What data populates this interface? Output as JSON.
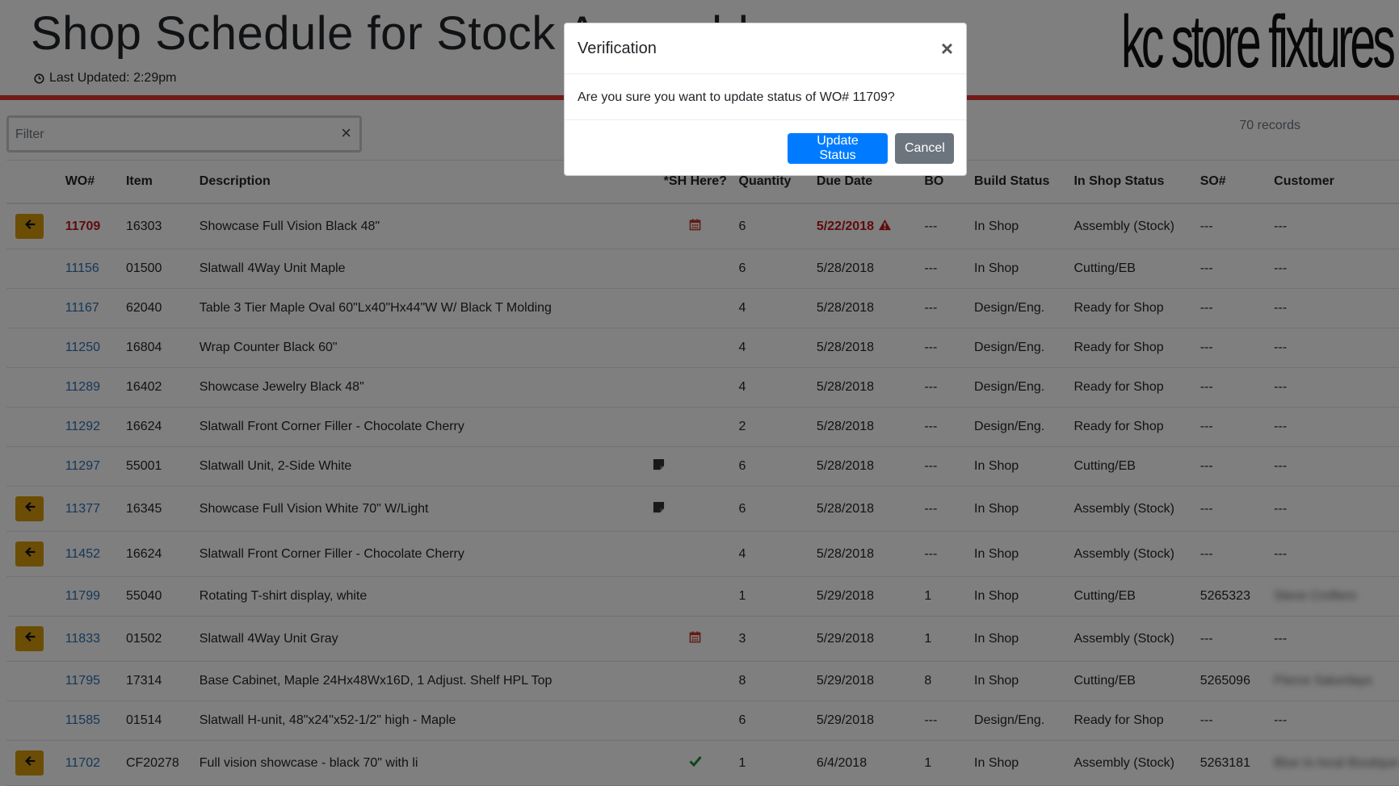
{
  "header": {
    "title": "Shop Schedule for Stock Assembly",
    "last_updated": "Last Updated: 2:29pm",
    "logo_text": "kc store fixtures"
  },
  "filter": {
    "placeholder": "Filter",
    "value": ""
  },
  "records_count": "70 records",
  "table": {
    "columns": [
      "WO#",
      "Item",
      "Description",
      "*SH Here?",
      "Quantity",
      "Due Date",
      "BO",
      "Build Status",
      "In Shop Status",
      "SO#",
      "Customer"
    ],
    "rows": [
      {
        "action": true,
        "wo": "11709",
        "item": "16303",
        "description": "Showcase Full Vision Black 48\"",
        "sh": "calendar",
        "quantity": "6",
        "due": "5/22/2018",
        "overdue": true,
        "bo": "---",
        "build": "In Shop",
        "inshop": "Assembly (Stock)",
        "so": "---",
        "customer": "---"
      },
      {
        "action": false,
        "wo": "11156",
        "item": "01500",
        "description": "Slatwall 4Way Unit Maple",
        "sh": "",
        "quantity": "6",
        "due": "5/28/2018",
        "overdue": false,
        "bo": "---",
        "build": "In Shop",
        "inshop": "Cutting/EB",
        "so": "---",
        "customer": "---"
      },
      {
        "action": false,
        "wo": "11167",
        "item": "62040",
        "description": "Table 3 Tier Maple Oval 60\"Lx40\"Hx44\"W W/ Black T Molding",
        "sh": "",
        "quantity": "4",
        "due": "5/28/2018",
        "overdue": false,
        "bo": "---",
        "build": "Design/Eng.",
        "inshop": "Ready for Shop",
        "so": "---",
        "customer": "---"
      },
      {
        "action": false,
        "wo": "11250",
        "item": "16804",
        "description": "Wrap Counter Black 60\"",
        "sh": "",
        "quantity": "4",
        "due": "5/28/2018",
        "overdue": false,
        "bo": "---",
        "build": "Design/Eng.",
        "inshop": "Ready for Shop",
        "so": "---",
        "customer": "---"
      },
      {
        "action": false,
        "wo": "11289",
        "item": "16402",
        "description": "Showcase Jewelry Black 48\"",
        "sh": "",
        "quantity": "4",
        "due": "5/28/2018",
        "overdue": false,
        "bo": "---",
        "build": "Design/Eng.",
        "inshop": "Ready for Shop",
        "so": "---",
        "customer": "---"
      },
      {
        "action": false,
        "wo": "11292",
        "item": "16624",
        "description": "Slatwall Front Corner Filler - Chocolate Cherry",
        "sh": "",
        "quantity": "2",
        "due": "5/28/2018",
        "overdue": false,
        "bo": "---",
        "build": "Design/Eng.",
        "inshop": "Ready for Shop",
        "so": "---",
        "customer": "---"
      },
      {
        "action": false,
        "wo": "11297",
        "item": "55001",
        "description": "Slatwall Unit, 2-Side White",
        "sh": "note",
        "quantity": "6",
        "due": "5/28/2018",
        "overdue": false,
        "bo": "---",
        "build": "In Shop",
        "inshop": "Cutting/EB",
        "so": "---",
        "customer": "---"
      },
      {
        "action": true,
        "wo": "11377",
        "item": "16345",
        "description": "Showcase Full Vision White 70\" W/Light",
        "sh": "note",
        "quantity": "6",
        "due": "5/28/2018",
        "overdue": false,
        "bo": "---",
        "build": "In Shop",
        "inshop": "Assembly (Stock)",
        "so": "---",
        "customer": "---"
      },
      {
        "action": true,
        "wo": "11452",
        "item": "16624",
        "description": "Slatwall Front Corner Filler - Chocolate Cherry",
        "sh": "",
        "quantity": "4",
        "due": "5/28/2018",
        "overdue": false,
        "bo": "---",
        "build": "In Shop",
        "inshop": "Assembly (Stock)",
        "so": "---",
        "customer": "---"
      },
      {
        "action": false,
        "wo": "11799",
        "item": "55040",
        "description": "Rotating T-shirt display, white",
        "sh": "",
        "quantity": "1",
        "due": "5/29/2018",
        "overdue": false,
        "bo": "1",
        "build": "In Shop",
        "inshop": "Cutting/EB",
        "so": "5265323",
        "customer": "Steve Crofters"
      },
      {
        "action": true,
        "wo": "11833",
        "item": "01502",
        "description": "Slatwall 4Way Unit Gray",
        "sh": "calendar",
        "quantity": "3",
        "due": "5/29/2018",
        "overdue": false,
        "bo": "1",
        "build": "In Shop",
        "inshop": "Assembly (Stock)",
        "so": "---",
        "customer": "---"
      },
      {
        "action": false,
        "wo": "11795",
        "item": "17314",
        "description": "Base Cabinet, Maple 24Hx48Wx16D, 1 Adjust. Shelf HPL Top",
        "sh": "",
        "quantity": "8",
        "due": "5/29/2018",
        "overdue": false,
        "bo": "8",
        "build": "In Shop",
        "inshop": "Cutting/EB",
        "so": "5265096",
        "customer": "Pierce Saturdays"
      },
      {
        "action": false,
        "wo": "11585",
        "item": "01514",
        "description": "Slatwall H-unit, 48\"x24\"x52-1/2\" high - Maple",
        "sh": "",
        "quantity": "6",
        "due": "5/29/2018",
        "overdue": false,
        "bo": "---",
        "build": "Design/Eng.",
        "inshop": "Ready for Shop",
        "so": "---",
        "customer": "---"
      },
      {
        "action": true,
        "wo": "11702",
        "item": "CF20278",
        "description": "Full vision showcase - black 70\" with li",
        "sh": "check",
        "quantity": "1",
        "due": "6/4/2018",
        "overdue": false,
        "bo": "1",
        "build": "In Shop",
        "inshop": "Assembly (Stock)",
        "so": "5263181",
        "customer": "Blue to local Boutique"
      }
    ]
  },
  "modal": {
    "title": "Verification",
    "close_glyph": "×",
    "message": "Are you sure you want to update status of WO# 11709?",
    "confirm_label": "Update Status",
    "cancel_label": "Cancel"
  },
  "colors": {
    "accent_rule": "#e3342f",
    "link": "#2a6fb0",
    "overdue": "#c0161c",
    "action_button": "#d99a0a",
    "primary_button": "#007bff",
    "secondary_button": "#6c757d"
  }
}
